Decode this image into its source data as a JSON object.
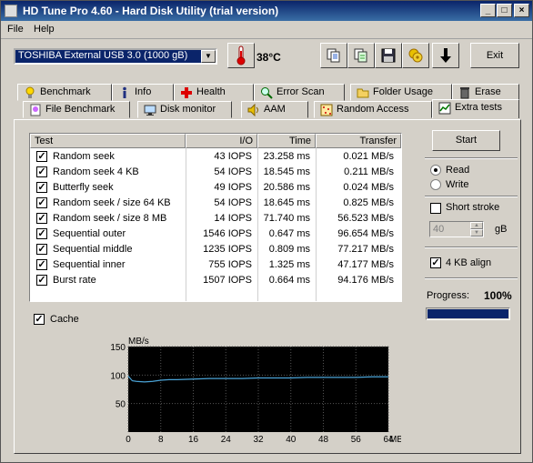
{
  "window": {
    "title": "HD Tune Pro 4.60 - Hard Disk Utility (trial version)"
  },
  "menu": [
    "File",
    "Help"
  ],
  "toolbar": {
    "drive": "TOSHIBA External USB 3.0 (1000 gB)",
    "temperature": "38°C",
    "exit_label": "Exit"
  },
  "tabs_row1": [
    {
      "label": "Benchmark",
      "icon": "bulb-icon"
    },
    {
      "label": "Info",
      "icon": "info-icon"
    },
    {
      "label": "Health",
      "icon": "health-cross-icon"
    },
    {
      "label": "Error Scan",
      "icon": "magnifier-icon"
    },
    {
      "label": "Folder Usage",
      "icon": "folder-icon"
    },
    {
      "label": "Erase",
      "icon": "trash-icon"
    }
  ],
  "tabs_row2": [
    {
      "label": "File Benchmark",
      "icon": "file-bulb-icon"
    },
    {
      "label": "Disk monitor",
      "icon": "monitor-icon"
    },
    {
      "label": "AAM",
      "icon": "speaker-icon"
    },
    {
      "label": "Random Access",
      "icon": "random-dots-icon"
    },
    {
      "label": "Extra tests",
      "icon": "extra-tests-icon"
    }
  ],
  "table": {
    "headers": [
      "Test",
      "I/O",
      "Time",
      "Transfer"
    ],
    "rows": [
      {
        "checked": true,
        "test": "Random seek",
        "io": "43 IOPS",
        "time": "23.258 ms",
        "transfer": "0.021 MB/s"
      },
      {
        "checked": true,
        "test": "Random seek 4 KB",
        "io": "54 IOPS",
        "time": "18.545 ms",
        "transfer": "0.211 MB/s"
      },
      {
        "checked": true,
        "test": "Butterfly seek",
        "io": "49 IOPS",
        "time": "20.586 ms",
        "transfer": "0.024 MB/s"
      },
      {
        "checked": true,
        "test": "Random seek / size 64 KB",
        "io": "54 IOPS",
        "time": "18.645 ms",
        "transfer": "0.825 MB/s"
      },
      {
        "checked": true,
        "test": "Random seek / size 8 MB",
        "io": "14 IOPS",
        "time": "71.740 ms",
        "transfer": "56.523 MB/s"
      },
      {
        "checked": true,
        "test": "Sequential outer",
        "io": "1546 IOPS",
        "time": "0.647 ms",
        "transfer": "96.654 MB/s"
      },
      {
        "checked": true,
        "test": "Sequential middle",
        "io": "1235 IOPS",
        "time": "0.809 ms",
        "transfer": "77.217 MB/s"
      },
      {
        "checked": true,
        "test": "Sequential inner",
        "io": "755 IOPS",
        "time": "1.325 ms",
        "transfer": "47.177 MB/s"
      },
      {
        "checked": true,
        "test": "Burst rate",
        "io": "1507 IOPS",
        "time": "0.664 ms",
        "transfer": "94.176 MB/s"
      }
    ]
  },
  "cache": {
    "label": "Cache",
    "checked": true
  },
  "controls": {
    "start_label": "Start",
    "read_label": "Read",
    "write_label": "Write",
    "mode": "Read",
    "short_stroke_label": "Short stroke",
    "short_stroke_checked": false,
    "stroke_value": "40",
    "stroke_unit": "gB",
    "align_label": "4 KB align",
    "align_checked": true,
    "progress_label": "Progress:",
    "progress_value": "100%",
    "progress_fraction": 1.0
  },
  "chart_data": {
    "type": "line",
    "ylabel": "MB/s",
    "xunit": "MB",
    "xlim": [
      0,
      64
    ],
    "ylim": [
      0,
      150
    ],
    "yticks": [
      50,
      100,
      150
    ],
    "xticks": [
      0,
      8,
      16,
      24,
      32,
      40,
      48,
      56,
      64
    ],
    "grid": true,
    "background": "#000000",
    "line_color": "#4aa3d6",
    "series": [
      {
        "x": [
          0,
          1,
          2,
          4,
          6,
          8,
          10,
          12,
          16,
          20,
          24,
          28,
          32,
          36,
          40,
          44,
          48,
          52,
          56,
          60,
          64
        ],
        "values": [
          98,
          90,
          89,
          88,
          89,
          91,
          92,
          92,
          93,
          94,
          94,
          94,
          95,
          95,
          95,
          96,
          96,
          96,
          96,
          97,
          97
        ]
      }
    ]
  }
}
